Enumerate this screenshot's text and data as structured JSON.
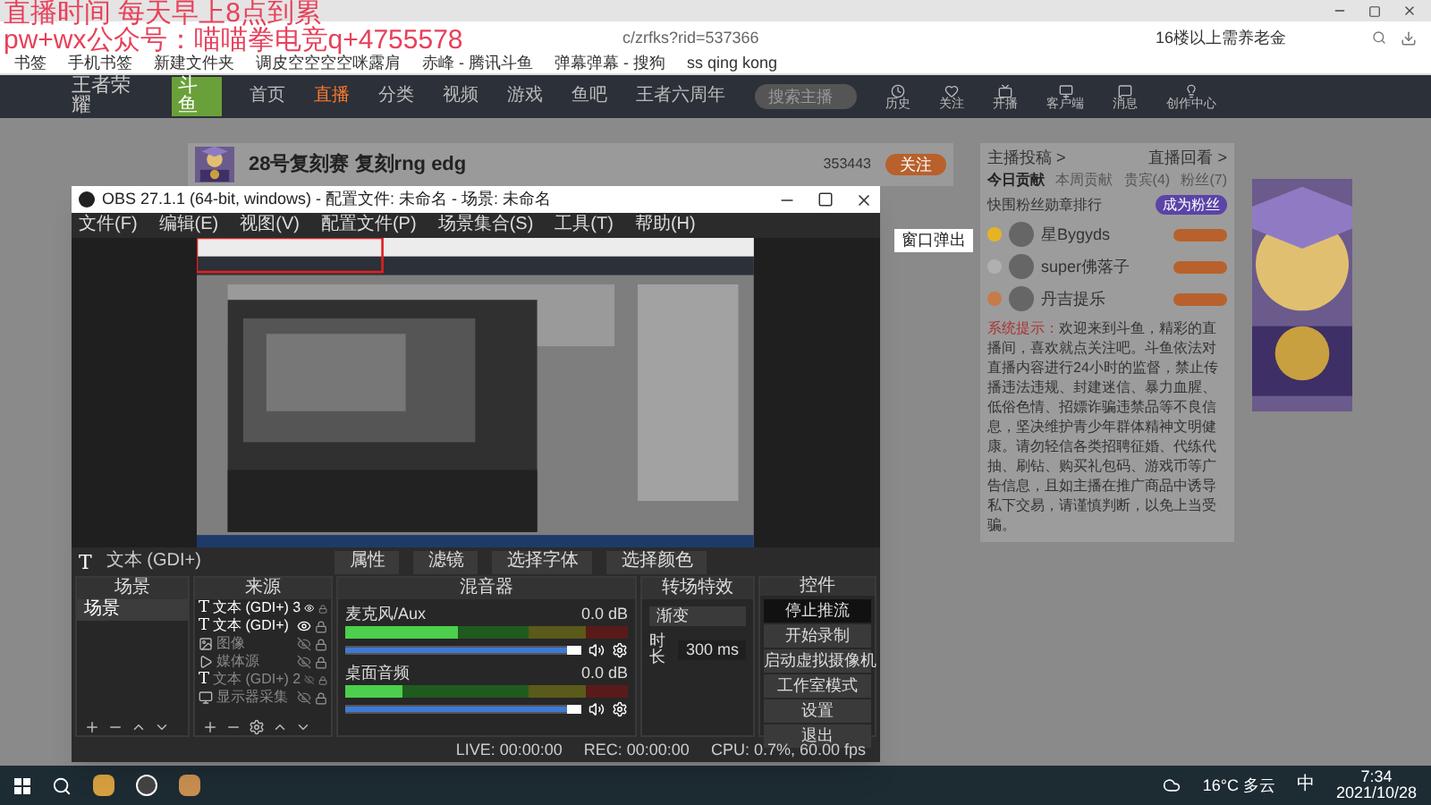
{
  "overlay": {
    "lines": [
      "直播时间 每天早上8点到累",
      "pw+wx公众号：喵喵拳电竞q+4755578"
    ]
  },
  "browser": {
    "url": "c/zrfks?rid=537366",
    "search_hint": "16楼以上需养老金",
    "bookmarks": [
      "书签",
      "手机书签",
      "新建文件夹",
      "调皮空空空空咪露肩",
      "赤峰 - 腾讯斗鱼",
      "弹幕弹幕 - 搜狗",
      "ss qing kong"
    ]
  },
  "site": {
    "logo": "王者荣耀",
    "brand": "斗鱼",
    "nav": [
      {
        "label": "首页",
        "selected": false
      },
      {
        "label": "直播",
        "selected": true
      },
      {
        "label": "分类",
        "selected": false
      },
      {
        "label": "视频",
        "selected": false
      },
      {
        "label": "游戏",
        "selected": false
      },
      {
        "label": "鱼吧",
        "selected": false
      },
      {
        "label": "王者六周年",
        "selected": false
      }
    ],
    "search_placeholder": "搜索主播",
    "tools": [
      "历史",
      "关注",
      "开播",
      "客户端",
      "消息",
      "创作中心"
    ]
  },
  "stream": {
    "title": "28号复刻赛 复刻rng edg",
    "followers": "353443",
    "follow_button": "关注"
  },
  "side": {
    "links": [
      "主播投稿 >",
      "直播回看 >"
    ],
    "tabs": [
      {
        "label": "今日贡献",
        "selected": true
      },
      {
        "label": "本周贡献",
        "selected": false
      },
      {
        "label": "贵宾(4)",
        "selected": false
      },
      {
        "label": "粉丝(7)",
        "selected": false
      }
    ],
    "rank_title": "快围粉丝勋章排行",
    "rank_button": "成为粉丝",
    "users": [
      {
        "name": "星Bygyds",
        "color": "#e6b422"
      },
      {
        "name": "super佛落子",
        "color": "#b0b0b0"
      },
      {
        "name": "丹吉提乐",
        "color": "#c77b4a"
      }
    ],
    "notice_label": "系统提示：",
    "notice": "欢迎来到斗鱼，精彩的直播间，喜欢就点关注吧。斗鱼依法对直播内容进行24小时的监督，禁止传播违法违规、封建迷信、暴力血腥、低俗色情、招嫖诈骗违禁品等不良信息，坚决维护青少年群体精神文明健康。请勿轻信各类招聘征婚、代练代抽、刷钻、购买礼包码、游戏币等广告信息，且如主播在推广商品中诱导私下交易，请谨慎判断，以免上当受骗。"
  },
  "popout_button": "窗口弹出",
  "obs": {
    "title": "OBS 27.1.1 (64-bit, windows) - 配置文件: 未命名 - 场景: 未命名",
    "menu": [
      "文件(F)",
      "编辑(E)",
      "视图(V)",
      "配置文件(P)",
      "场景集合(S)",
      "工具(T)",
      "帮助(H)"
    ],
    "source_bar": {
      "icon": "T",
      "name": "文本 (GDI+)",
      "buttons": [
        "属性",
        "滤镜",
        "选择字体",
        "选择颜色"
      ]
    },
    "scenes": {
      "title": "场景",
      "items": [
        {
          "label": "场景",
          "selected": true
        }
      ]
    },
    "sources": {
      "title": "来源",
      "items": [
        {
          "kind": "text",
          "icon": "T",
          "label": "文本 (GDI+) 3",
          "visible": true
        },
        {
          "kind": "text",
          "icon": "T",
          "label": "文本 (GDI+)",
          "visible": true
        },
        {
          "label": "图像",
          "visible": false
        },
        {
          "kind": "media",
          "label": "媒体源",
          "visible": false
        },
        {
          "kind": "text",
          "icon": "T",
          "label": "文本 (GDI+) 2",
          "visible": false
        },
        {
          "kind": "display",
          "label": "显示器采集",
          "visible": false
        }
      ]
    },
    "mixer": {
      "title": "混音器",
      "channels": [
        {
          "name": "麦克风/Aux",
          "reading": "0.0 dB",
          "meter": {
            "level": 0.4
          },
          "fader": {
            "level": 1
          }
        },
        {
          "name": "桌面音频",
          "reading": "0.0 dB",
          "meter": {
            "level": 0.2
          },
          "fader": {
            "level": 1
          }
        }
      ]
    },
    "transitions": {
      "title": "转场特效",
      "type": "渐变",
      "duration_label": "时长",
      "duration": "300 ms"
    },
    "controls": {
      "title": "控件",
      "buttons": [
        {
          "label": "停止推流",
          "active": true
        },
        {
          "label": "开始录制",
          "active": false
        },
        {
          "label": "启动虚拟摄像机",
          "active": false
        },
        {
          "label": "工作室模式",
          "active": false
        },
        {
          "label": "设置",
          "active": false
        },
        {
          "label": "退出",
          "active": false
        }
      ]
    },
    "status": {
      "live": "LIVE: 00:00:00",
      "rec": "REC: 00:00:00",
      "cpu": "CPU: 0.7%, 60.00 fps"
    }
  },
  "taskbar": {
    "weather": "16°C 多云",
    "ime": "中",
    "time": "7:34",
    "date": "2021/10/28"
  }
}
